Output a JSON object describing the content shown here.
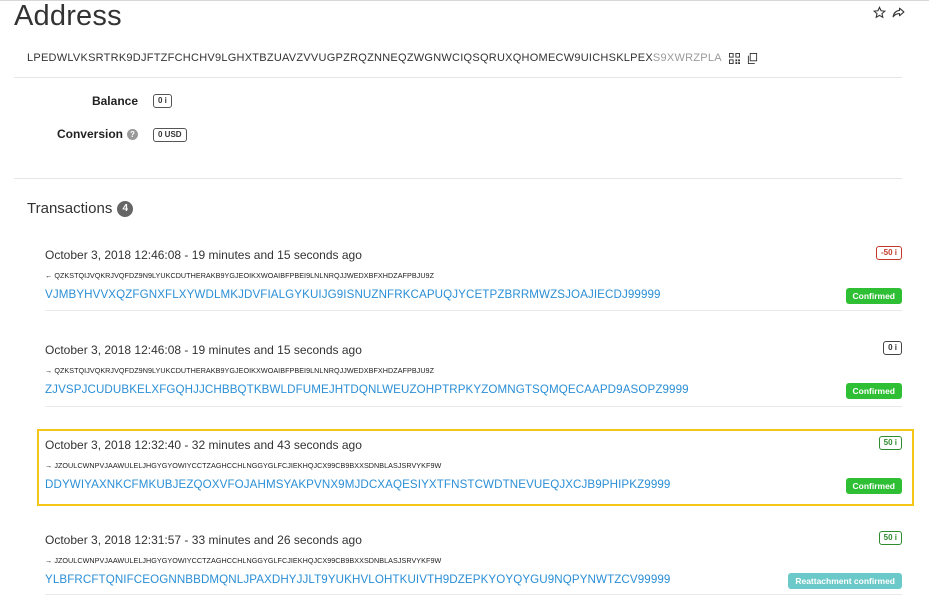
{
  "page": {
    "title": "Address",
    "icons": {
      "favorite": "star-outline-icon",
      "share": "share-icon"
    }
  },
  "address": {
    "main": "LPEDWLVKSRTRK9DJFTZFCHCHV9LGHXTBZUAVZVVUGPZRQZNNEQZWGNWCIQSQRUXQHOMECW9UICHSKLPEX",
    "checksum": "S9XWRZPLA",
    "icons": {
      "qr": "qr-code-icon",
      "copy": "copy-icon"
    }
  },
  "summary": {
    "balance_label": "Balance",
    "balance_value": "0 i",
    "conversion_label": "Conversion",
    "conversion_help_icon": "question-circle-icon",
    "conversion_value": "0 USD"
  },
  "transactions": {
    "heading": "Transactions",
    "count": "4",
    "items": [
      {
        "timestamp": "October 3, 2018 12:46:08 - 19 minutes and 15 seconds ago",
        "direction": "←",
        "counterparty": "QZKSTQIJVQKRJVQFDZ9N9LYUKCDUTHERAKB9YGJEOIKXWOAIBFPBEI9LNLNRQJJWEDXBFXHDZAFPBJU9Z",
        "hash": "VJMBYHVVXQZFGNXFLXYWDLMKJDVFIALGYKUIJG9ISNUZNFRKCAPUQJYCETPZBRRMWZSJOAJIECDJ99999",
        "amount": "-50 i",
        "status": "Confirmed"
      },
      {
        "timestamp": "October 3, 2018 12:46:08 - 19 minutes and 15 seconds ago",
        "direction": "→",
        "counterparty": "QZKSTQIJVQKRJVQFDZ9N9LYUKCDUTHERAKB9YGJEOIKXWOAIBFPBEI9LNLNRQJJWEDXBFXHDZAFPBJU9Z",
        "hash": "ZJVSPJCUDUBKELXFGQHJJCHBBQTKBWLDFUMEJHTDQNLWEUZOHPTRPKYZOMNGTSQMQECAAPD9ASOPZ9999",
        "amount": "0 i",
        "status": "Confirmed"
      },
      {
        "timestamp": "October 3, 2018 12:32:40 - 32 minutes and 43 seconds ago",
        "direction": "→",
        "counterparty": "JZOULCWNPVJAAWULELJHGYGYOWIYCCTZAGHCCHLNGGYGLFCJIEKHQJCX99CB9BXXSDNBLASJSRVYKF9W",
        "hash": "DDYWIYAXNKCFMKUBJEZQOXVFOJAHMSYAKPVNX9MJDCXAQESIYXTFNSTCWDTNEVUEQJXCJB9PHIPKZ9999",
        "amount": "50 i",
        "status": "Confirmed"
      },
      {
        "timestamp": "October 3, 2018 12:31:57 - 33 minutes and 26 seconds ago",
        "direction": "→",
        "counterparty": "JZOULCWNPVJAAWULELJHGYGYOWIYCCTZAGHCCHLNGGYGLFCJIEKHQJCX99CB9BXXSDNBLASJSRVYKF9W",
        "hash": "YLBFRCFTQNIFCEOGNNBBDMQNLJPAXDHYJJLT9YUKHVLOHTKUIVTH9DZEPKYOYQYGU9NQPYNWTZCV99999",
        "amount": "50 i",
        "status": "Reattachment confirmed"
      }
    ]
  },
  "colors": {
    "link": "#2b8fd6",
    "confirmed": "#2fbf35",
    "reattachment": "#6cc9c9",
    "negative_amount": "#c0392b",
    "positive_amount": "#2e8b2e",
    "neutral_amount": "#444444",
    "highlight": "#f5c518"
  }
}
